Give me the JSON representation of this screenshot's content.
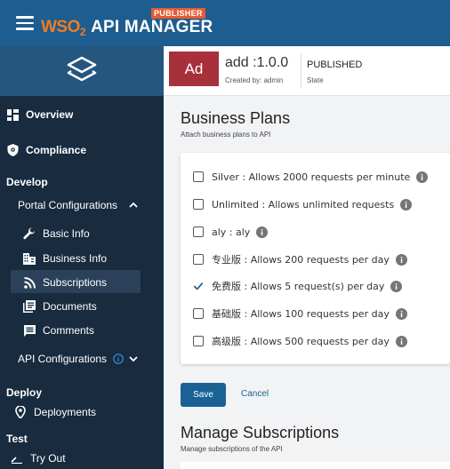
{
  "topbar": {
    "logo_wso": "WSO",
    "logo_sub": "2",
    "app_name": "API MANAGER",
    "badge": "PUBLISHER"
  },
  "sidebar": {
    "overview": "Overview",
    "compliance": "Compliance",
    "develop_title": "Develop",
    "portal_config": "Portal Configurations",
    "basic_info": "Basic Info",
    "business_info": "Business Info",
    "subscriptions": "Subscriptions",
    "documents": "Documents",
    "comments": "Comments",
    "api_config": "API Configurations",
    "deploy_title": "Deploy",
    "deployments": "Deployments",
    "test_title": "Test",
    "try_out": "Try Out"
  },
  "api": {
    "thumb": "Ad",
    "name": "add :1.0.0",
    "created_by": "Created by: admin",
    "state": "PUBLISHED",
    "state_label": "State"
  },
  "business_plans": {
    "title": "Business Plans",
    "subtitle": "Attach business plans to API",
    "plans": [
      {
        "label": "Silver : Allows 2000 requests per minute",
        "checked": false
      },
      {
        "label": "Unlimited : Allows unlimited requests",
        "checked": false
      },
      {
        "label": "aly : aly",
        "checked": false
      },
      {
        "label": "专业版 : Allows 200 requests per day",
        "checked": false
      },
      {
        "label": "免费版 : Allows 5 request(s) per day",
        "checked": true
      },
      {
        "label": "基础版 : Allows 100 requests per day",
        "checked": false
      },
      {
        "label": "高级版 : Allows 500 requests per day",
        "checked": false
      }
    ],
    "save": "Save",
    "cancel": "Cancel"
  },
  "manage_subscriptions": {
    "title": "Manage Subscriptions",
    "subtitle": "Manage subscriptions of the API"
  },
  "colors": {
    "topbar": "#1d5d8f",
    "sidebar": "#182b3f",
    "primary": "#1a6296",
    "thumb": "#a8303b",
    "badge": "#e35b33"
  }
}
